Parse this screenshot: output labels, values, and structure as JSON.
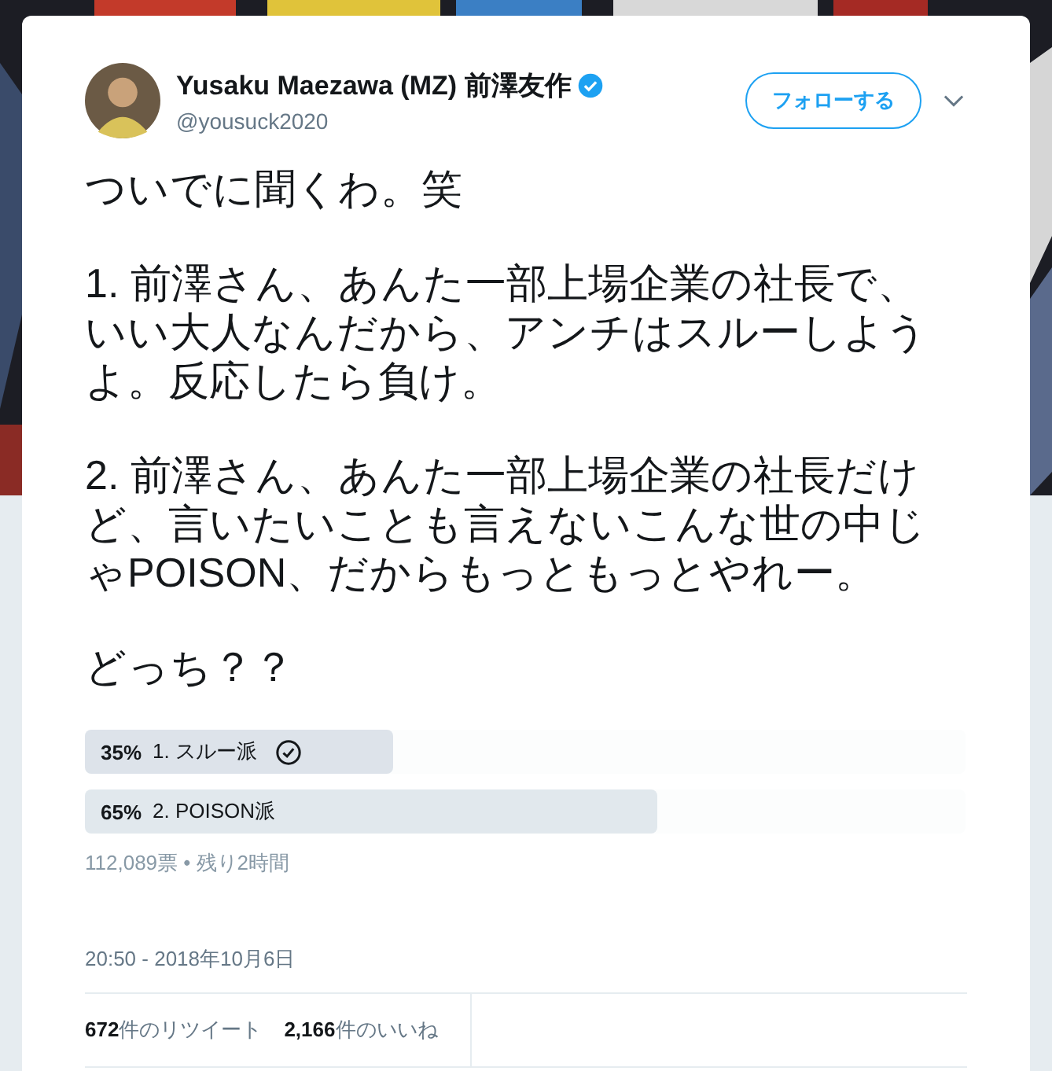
{
  "author": {
    "name": "Yusaku Maezawa (MZ) 前澤友作",
    "verified": true,
    "handle": "@yousuck2020"
  },
  "follow_button": "フォローする",
  "tweet": {
    "paragraphs": [
      "ついでに聞くわ。笑",
      "1. 前澤さん、あんた一部上場企業の社長で、いい大人なんだから、アンチはスルーしようよ。反応したら負け。",
      "2. 前澤さん、あんた一部上場企業の社長だけど、言いたいことも言えないこんな世の中じゃPOISON、だからもっともっとやれー。",
      "どっち？？"
    ]
  },
  "poll": {
    "choices": [
      {
        "percent": "35%",
        "label": "1. スルー派",
        "level": 0.35,
        "selected": true
      },
      {
        "percent": "65%",
        "label": "2. POISON派",
        "level": 0.65,
        "selected": false
      }
    ],
    "summary": "112,089票 • 残り2時間"
  },
  "timestamp": "20:50 - 2018年10月6日",
  "stats": [
    "**672**件のリツイート",
    "**2,166**件のいいね"
  ]
}
